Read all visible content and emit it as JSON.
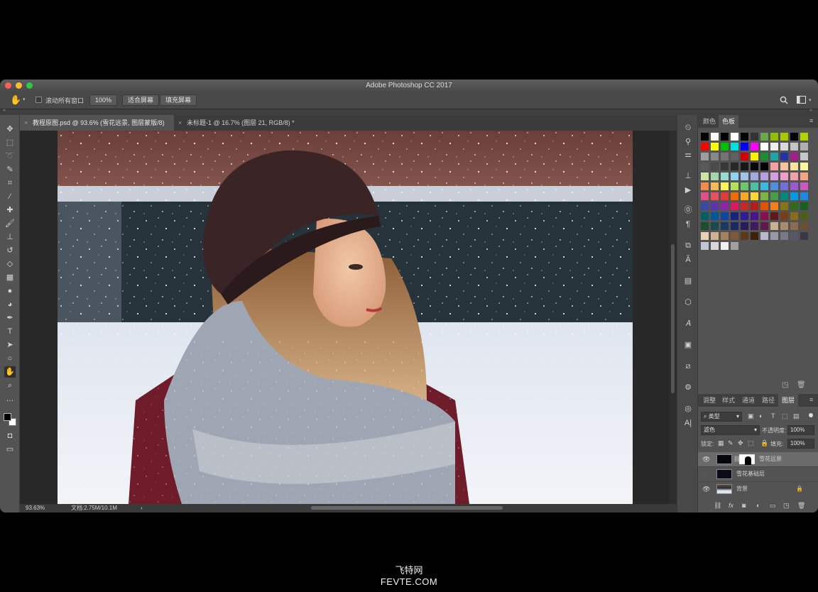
{
  "window": {
    "title": "Adobe Photoshop CC 2017"
  },
  "options_bar": {
    "scroll_all_windows": "滚动所有窗口",
    "zoom_100": "100%",
    "fit_screen": "适合屏幕",
    "fill_screen": "填充屏幕"
  },
  "document_tabs": [
    {
      "label": "教程原图.psd @ 93.6% (雪花远景, 图层蒙版/8) *"
    },
    {
      "label": "未标题-1 @ 16.7% (图层 21, RGB/8) *"
    }
  ],
  "status": {
    "zoom": "93.63%",
    "doc_size": "文档:2.75M/10.1M",
    "arrow": "›"
  },
  "color_panel": {
    "tabs": [
      "颜色",
      "色板"
    ],
    "active_tab": "色板"
  },
  "swatch_rows": [
    [
      "#000000",
      "#ffffff",
      "#000000",
      "#ffffff",
      "#000000",
      "#333333",
      "#6aa84f",
      "#8fbf00",
      "#a8c800",
      "#000000",
      "#b5d000"
    ],
    [
      "#ff0000",
      "#ffff00",
      "#00c000",
      "#00e0e0",
      "#0000ff",
      "#ff00ff",
      "#ffffff",
      "#ededed",
      "#d9d9d9",
      "#c4c4c4",
      "#b0b0b0"
    ],
    [
      "#9c9c9c",
      "#888888",
      "#747474",
      "#606060",
      "#d40000",
      "#ffee00",
      "#1c8e2e",
      "#1ea6a6",
      "#2332a5",
      "#a51c8e",
      "#c6c6c6"
    ],
    [
      "#5a5a5a",
      "#4a4a4a",
      "#383838",
      "#282828",
      "#181818",
      "#080808",
      "#000000",
      "#f2a0a0",
      "#f5c2a0",
      "#f7e39e",
      "#fff99e"
    ],
    [
      "#c8e6a0",
      "#a5d6a7",
      "#99dbd0",
      "#8fd3f0",
      "#9fc5e8",
      "#a4a8e0",
      "#b69ee0",
      "#d39ee0",
      "#f09ec8",
      "#f0a0a8",
      "#f4a582"
    ],
    [
      "#f08c50",
      "#f7b955",
      "#fff35a",
      "#b5e05a",
      "#6cc86a",
      "#4cc0a0",
      "#3cb8e0",
      "#4f8fe0",
      "#7070d8",
      "#9a5ad0",
      "#c85ac0"
    ],
    [
      "#e0508c",
      "#e85060",
      "#e53935",
      "#ef6c00",
      "#f9a825",
      "#fdd835",
      "#7cb342",
      "#43a047",
      "#00897b",
      "#039be5",
      "#1e88e5"
    ],
    [
      "#3949ab",
      "#5e35b1",
      "#8e24aa",
      "#d81b60",
      "#c62828",
      "#b71c1c",
      "#e65100",
      "#f57f17",
      "#827717",
      "#33691e",
      "#1b5e20"
    ],
    [
      "#006064",
      "#01579b",
      "#0d47a1",
      "#1a237e",
      "#311b92",
      "#4a148c",
      "#880e4f",
      "#5d1a1a",
      "#7a3d1a",
      "#8a6d1a",
      "#4e5e1a"
    ],
    [
      "#1a4e2e",
      "#1a4a4e",
      "#1a3a5e",
      "#1a2a5e",
      "#2a1a5e",
      "#3e1a5e",
      "#5e1a4a",
      "#c8b090",
      "#a88c6c",
      "#8c6c4c",
      "#6c5034"
    ],
    [
      "#e8d0b0",
      "#d0b090",
      "#a88058",
      "#805838",
      "#603818",
      "#402008",
      "#b8b8c8",
      "#9898a8",
      "#787888",
      "#585868",
      "#383848"
    ],
    [
      "#c0c8d8",
      "#d8d8d8",
      "#f0f0f0",
      "#a0a0a0"
    ]
  ],
  "layers_panel": {
    "tabs": [
      "调整",
      "样式",
      "通道",
      "路径",
      "图层"
    ],
    "active_tab": "图层",
    "filter_kind": "类型",
    "blend_mode": "滤色",
    "opacity_label": "不透明度:",
    "opacity_value": "100%",
    "lock_label": "锁定:",
    "fill_label": "填充:",
    "fill_value": "100%",
    "layers": [
      {
        "name": "雪花远景",
        "visible": true,
        "selected": true
      },
      {
        "name": "雪花基础层",
        "visible": false,
        "selected": false
      },
      {
        "name": "背景",
        "visible": true,
        "selected": false,
        "locked": true
      }
    ],
    "footer_icons": [
      "link-icon",
      "fx-icon",
      "mask-icon",
      "adjustment-icon",
      "group-icon",
      "new-layer-icon",
      "delete-icon"
    ]
  },
  "watermark": {
    "line1": "飞特网",
    "line2": "FEVTE.COM"
  },
  "colors": {
    "accent_close": "#fc5f57",
    "accent_min": "#fdbc2e",
    "accent_max": "#33c748",
    "fg_color": "#000000",
    "bg_color": "#ffffff"
  }
}
